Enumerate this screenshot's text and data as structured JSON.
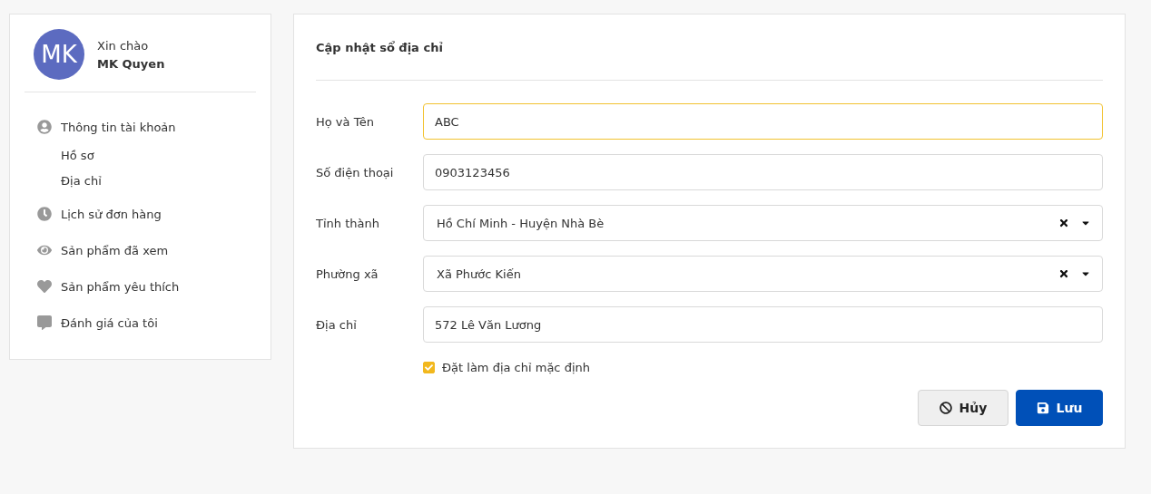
{
  "user": {
    "initials": "MK",
    "greeting": "Xin chào",
    "name": "MK Quyen"
  },
  "menu": [
    {
      "kind": "group",
      "label": "Thông tin tài khoản",
      "children": [
        {
          "label": "Hồ sơ"
        },
        {
          "label": "Địa chỉ"
        }
      ]
    },
    {
      "kind": "item",
      "label": "Lịch sử đơn hàng"
    },
    {
      "kind": "item",
      "label": "Sản phẩm đã xem"
    },
    {
      "kind": "item",
      "label": "Sản phẩm yêu thích"
    },
    {
      "kind": "item",
      "label": "Đánh giá của tôi"
    }
  ],
  "form": {
    "title": "Cập nhật sổ địa chỉ",
    "fields": [
      {
        "kind": "text",
        "label": "Họ và Tên",
        "value": "ABC",
        "focused": true
      },
      {
        "kind": "text",
        "label": "Số điện thoại",
        "value": "0903123456",
        "focused": false
      },
      {
        "kind": "select",
        "label": "Tỉnh thành",
        "value": "Hồ Chí Minh - Huyện Nhà Bè",
        "focused": false
      },
      {
        "kind": "select",
        "label": "Phường xã",
        "value": "Xã Phước Kiến",
        "focused": false
      },
      {
        "kind": "text",
        "label": "Địa chỉ",
        "value": "572 Lê Văn Lương",
        "focused": false
      }
    ],
    "default_checkbox": {
      "label": "Đặt làm địa chỉ mặc định",
      "checked": true
    },
    "buttons": [
      {
        "kind": "cancel",
        "label": "Hủy"
      },
      {
        "kind": "save",
        "label": "Lưu"
      }
    ]
  }
}
